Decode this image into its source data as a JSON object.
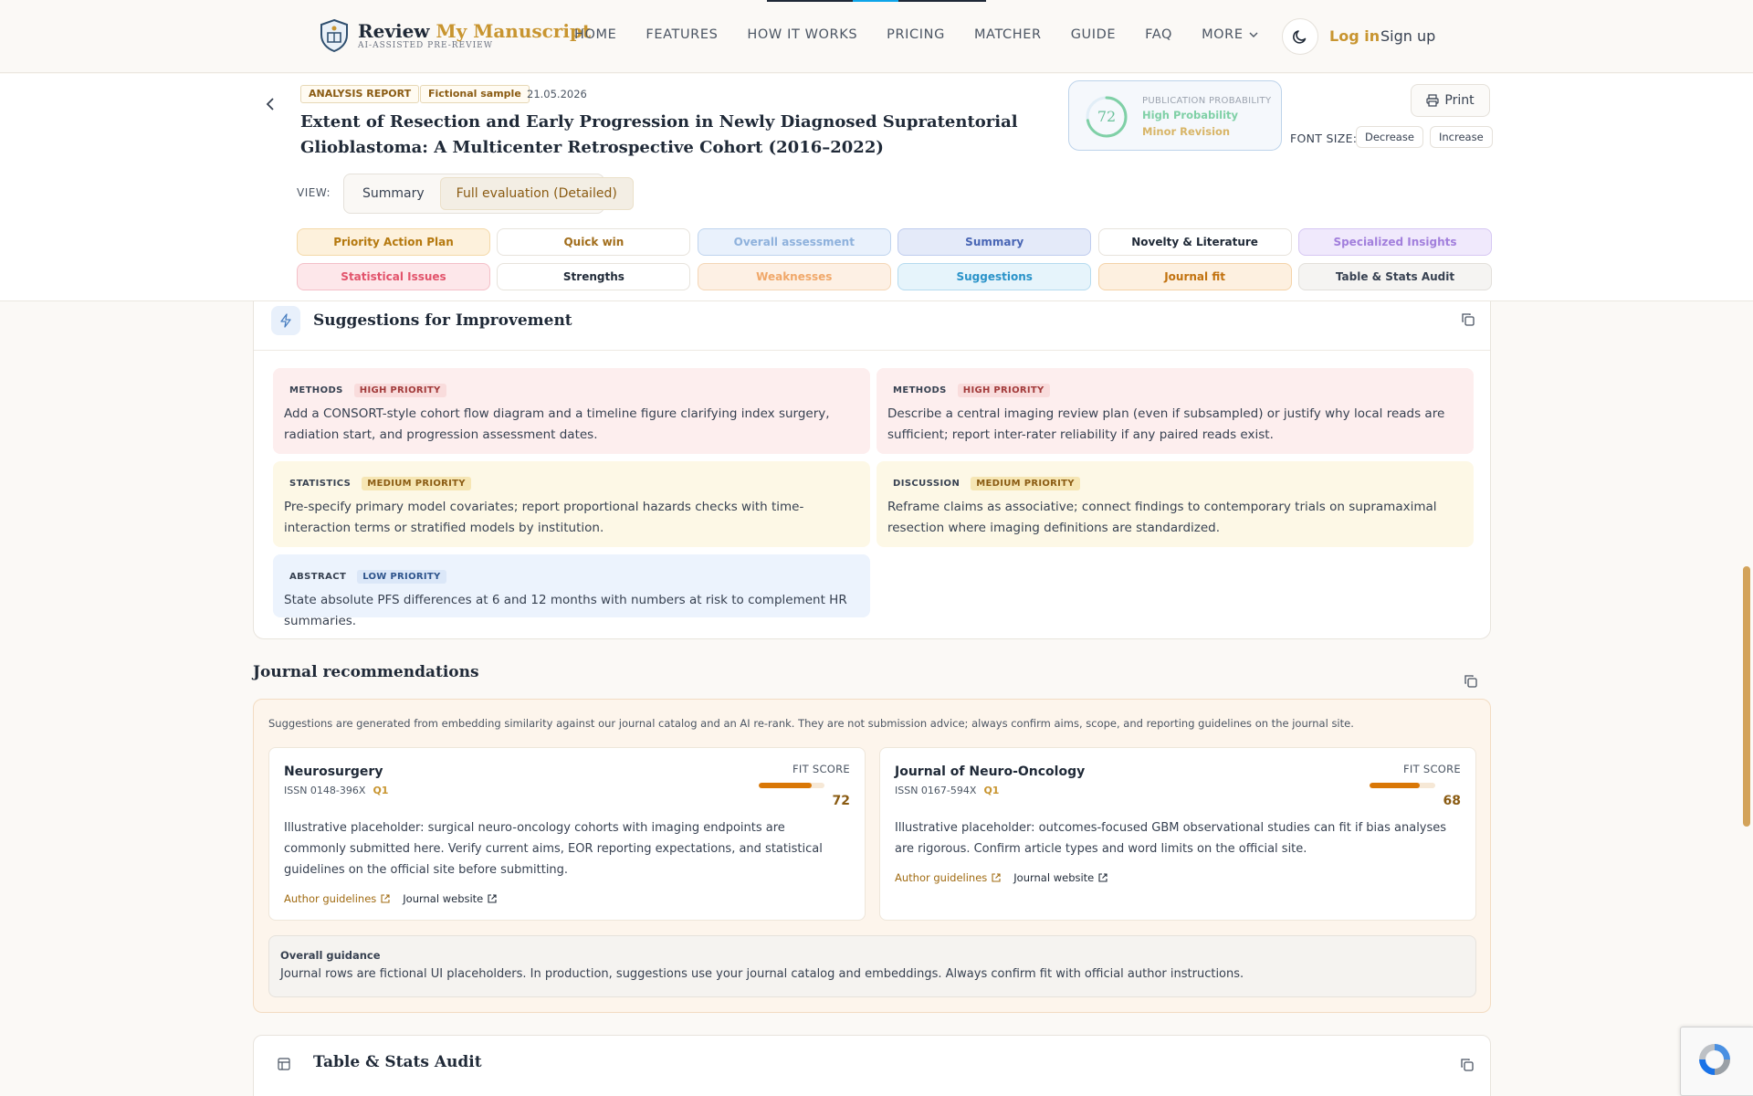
{
  "brand": {
    "name_main": "Review ",
    "name_accent": "My Manuscript",
    "tagline": "AI-ASSISTED PRE-REVIEW"
  },
  "nav": {
    "links": [
      "HOME",
      "FEATURES",
      "HOW IT WORKS",
      "PRICING",
      "MATCHER",
      "GUIDE",
      "FAQ"
    ],
    "more": "MORE",
    "login": "Log in",
    "signup": "Sign up"
  },
  "report": {
    "chip_type": "ANALYSIS REPORT",
    "chip_sample": "Fictional sample",
    "date": "21.05.2026",
    "title": "Extent of Resection and Early Progression in Newly Diagnosed Supratentorial Glioblastoma: A Multicenter Retrospective Cohort (2016–2022)",
    "probability": {
      "label": "PUBLICATION PROBABILITY",
      "score": "72",
      "score_fraction": 0.72,
      "level": "High Probability",
      "revision": "Minor Revision"
    },
    "print_label": "Print",
    "font_size_label": "FONT SIZE:",
    "decrease_label": "Decrease",
    "increase_label": "Increase",
    "view_label": "VIEW:",
    "view_options": [
      "Summary",
      "Full evaluation (Detailed)"
    ],
    "view_selected": "Full evaluation (Detailed)"
  },
  "section_tabs": [
    {
      "label": "Priority Action Plan",
      "bg": "#fdf1dc",
      "border": "#f4d9a8",
      "color": "#b5790f"
    },
    {
      "label": "Quick win",
      "bg": "#ffffff",
      "border": "#e7e3dc",
      "color": "#a16d1b"
    },
    {
      "label": "Overall assessment",
      "bg": "#e9f1fc",
      "border": "#bfd4ee",
      "color": "#8eb1dc"
    },
    {
      "label": "Summary",
      "bg": "#e4eaf9",
      "border": "#bfccee",
      "color": "#4966b5"
    },
    {
      "label": "Novelty & Literature",
      "bg": "#ffffff",
      "border": "#e7e3dc",
      "color": "#1f2937"
    },
    {
      "label": "Specialized Insights",
      "bg": "#f0e9fc",
      "border": "#d6c7f3",
      "color": "#a27fdc"
    },
    {
      "label": "Statistical Issues",
      "bg": "#fde7ea",
      "border": "#f4c0c8",
      "color": "#e2536b"
    },
    {
      "label": "Strengths",
      "bg": "#ffffff",
      "border": "#e7e3dc",
      "color": "#1f2937"
    },
    {
      "label": "Weaknesses",
      "bg": "#fdf0e4",
      "border": "#f4d6b6",
      "color": "#f0a86a"
    },
    {
      "label": "Suggestions",
      "bg": "#e6f4fb",
      "border": "#b5dbef",
      "color": "#2a93c9"
    },
    {
      "label": "Journal fit",
      "bg": "#fdf0e0",
      "border": "#f4d3a8",
      "color": "#c2720f"
    },
    {
      "label": "Table & Stats Audit",
      "bg": "#f5f4f2",
      "border": "#e2dfda",
      "color": "#374151"
    }
  ],
  "suggestions": {
    "title": "Suggestions for Improvement",
    "items": [
      {
        "category": "METHODS",
        "priority": "HIGH PRIORITY",
        "level": "high",
        "text": "Add a CONSORT-style cohort flow diagram and a timeline figure clarifying index surgery, radiation start, and progression assessment dates."
      },
      {
        "category": "METHODS",
        "priority": "HIGH PRIORITY",
        "level": "high",
        "text": "Describe a central imaging review plan (even if subsampled) or justify why local reads are sufficient; report inter-rater reliability if any paired reads exist."
      },
      {
        "category": "STATISTICS",
        "priority": "MEDIUM PRIORITY",
        "level": "med",
        "text": "Pre-specify primary model covariates; report proportional hazards checks with time-interaction terms or stratified models by institution."
      },
      {
        "category": "DISCUSSION",
        "priority": "MEDIUM PRIORITY",
        "level": "med",
        "text": "Reframe claims as associative; connect findings to contemporary trials on supramaximal resection where imaging definitions are standardized."
      },
      {
        "category": "ABSTRACT",
        "priority": "LOW PRIORITY",
        "level": "low",
        "text": "State absolute PFS differences at 6 and 12 months with numbers at risk to complement HR summaries."
      }
    ]
  },
  "journals": {
    "title": "Journal recommendations",
    "note": "Suggestions are generated from embedding similarity against our journal catalog and an AI re-rank. They are not submission advice; always confirm aims, scope, and reporting guidelines on the journal site.",
    "fit_label": "FIT SCORE",
    "author_guidelines": "Author guidelines",
    "journal_website": "Journal website",
    "items": [
      {
        "name": "Neurosurgery",
        "issn": "ISSN 0148-396X",
        "quartile": "Q1",
        "score": "72",
        "fit_fraction": 0.8,
        "desc": "Illustrative placeholder: surgical neuro-oncology cohorts with imaging endpoints are commonly submitted here. Verify current aims, EOR reporting expectations, and statistical guidelines on the official site before submitting."
      },
      {
        "name": "Journal of Neuro-Oncology",
        "issn": "ISSN 0167-594X",
        "quartile": "Q1",
        "score": "68",
        "fit_fraction": 0.76,
        "desc": "Illustrative placeholder: outcomes-focused GBM observational studies can fit if bias analyses are rigorous. Confirm article types and word limits on the official site."
      }
    ],
    "guidance_label": "Overall guidance",
    "guidance_text": "Journal rows are fictional UI placeholders. In production, suggestions use your journal catalog and embeddings. Always confirm fit with official author instructions."
  },
  "audit": {
    "title": "Table & Stats Audit"
  },
  "colors": {
    "accent": "#c89530",
    "fit_bar": "#d97706",
    "probability_ring": "#7fd0a6"
  }
}
